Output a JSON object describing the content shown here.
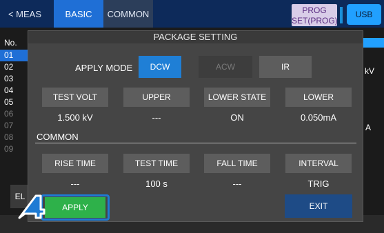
{
  "topbar": {
    "meas_tab": "< MEAS",
    "basic_tab": "BASIC",
    "common_tab": "COMMON",
    "prog_top": "PROG",
    "prog_bottom": "SET(PROG)",
    "usb": "USB"
  },
  "background": {
    "no_label": "No.",
    "rows": [
      "01",
      "02",
      "03",
      "04",
      "05",
      "06",
      "07",
      "08",
      "09"
    ],
    "selected_row": "01",
    "right_unit_kv": "kV",
    "right_unit_a": "A",
    "left_button": "EL"
  },
  "modal": {
    "title": "PACKAGE SETTING",
    "apply_mode_label": "APPLY MODE",
    "modes": [
      "DCW",
      "ACW",
      "IR"
    ],
    "selected_mode": "DCW",
    "params_row1": [
      {
        "label": "TEST VOLT",
        "value": "1.500 kV"
      },
      {
        "label": "UPPER",
        "value": "---"
      },
      {
        "label": "LOWER STATE",
        "value": "ON"
      },
      {
        "label": "LOWER",
        "value": "0.050mA"
      }
    ],
    "common_label": "COMMON",
    "params_row2": [
      {
        "label": "RISE TIME",
        "value": "---"
      },
      {
        "label": "TEST TIME",
        "value": "100 s"
      },
      {
        "label": "FALL TIME",
        "value": "---"
      },
      {
        "label": "INTERVAL",
        "value": "TRIG"
      }
    ],
    "apply_button": "APPLY",
    "exit_button": "EXIT"
  },
  "annotation": {
    "step_number": "4",
    "badge_color": "#1e7bd4"
  },
  "colors": {
    "accent_blue": "#1f7fd6",
    "apply_green": "#2eb14a",
    "prog_purple": "#d9cde8",
    "usb_blue": "#21a0ff"
  }
}
